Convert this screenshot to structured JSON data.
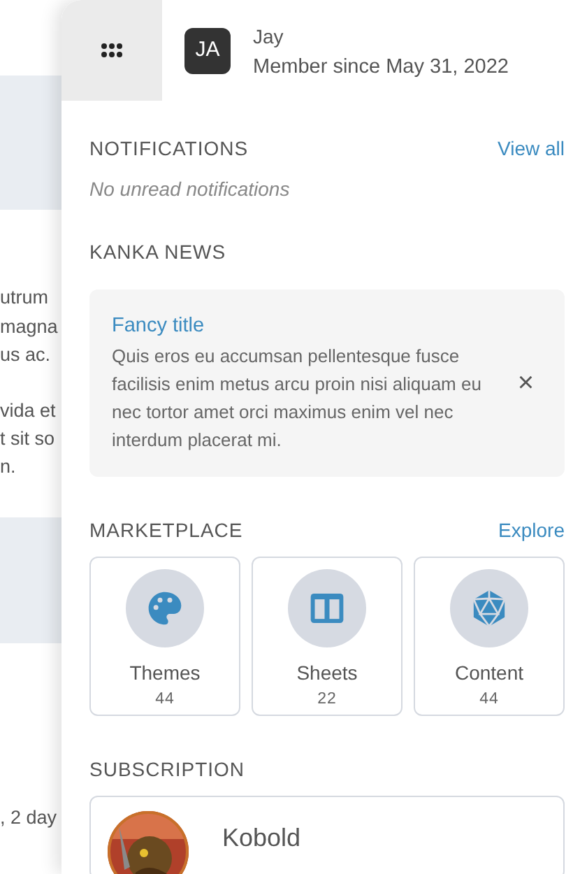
{
  "background": {
    "lines": [
      {
        "text": "utrum"
      },
      {
        "text": "magna"
      },
      {
        "text": "us ac."
      },
      {
        "text": "vida et"
      },
      {
        "text": "t sit so"
      },
      {
        "text": "n."
      },
      {
        "text": ", 2 day"
      }
    ]
  },
  "user": {
    "initials": "JA",
    "name": "Jay",
    "member_since": "Member since May 31, 2022"
  },
  "notifications": {
    "heading": "NOTIFICATIONS",
    "link": "View all",
    "empty": "No unread notifications"
  },
  "news": {
    "heading": "KANKA NEWS",
    "items": [
      {
        "title": "Fancy title",
        "body": "Quis eros eu accumsan pellentesque fusce facilisis enim metus arcu proin nisi aliquam eu nec tortor amet orci maximus enim vel nec interdum placerat mi.",
        "close": "×"
      }
    ]
  },
  "marketplace": {
    "heading": "MARKETPLACE",
    "link": "Explore",
    "tiles": [
      {
        "kind": "palette",
        "label": "Themes",
        "count": "44"
      },
      {
        "kind": "columns",
        "label": "Sheets",
        "count": "22"
      },
      {
        "kind": "d20",
        "label": "Content",
        "count": "44"
      }
    ]
  },
  "subscription": {
    "heading": "SUBSCRIPTION",
    "tier": "Kobold"
  }
}
